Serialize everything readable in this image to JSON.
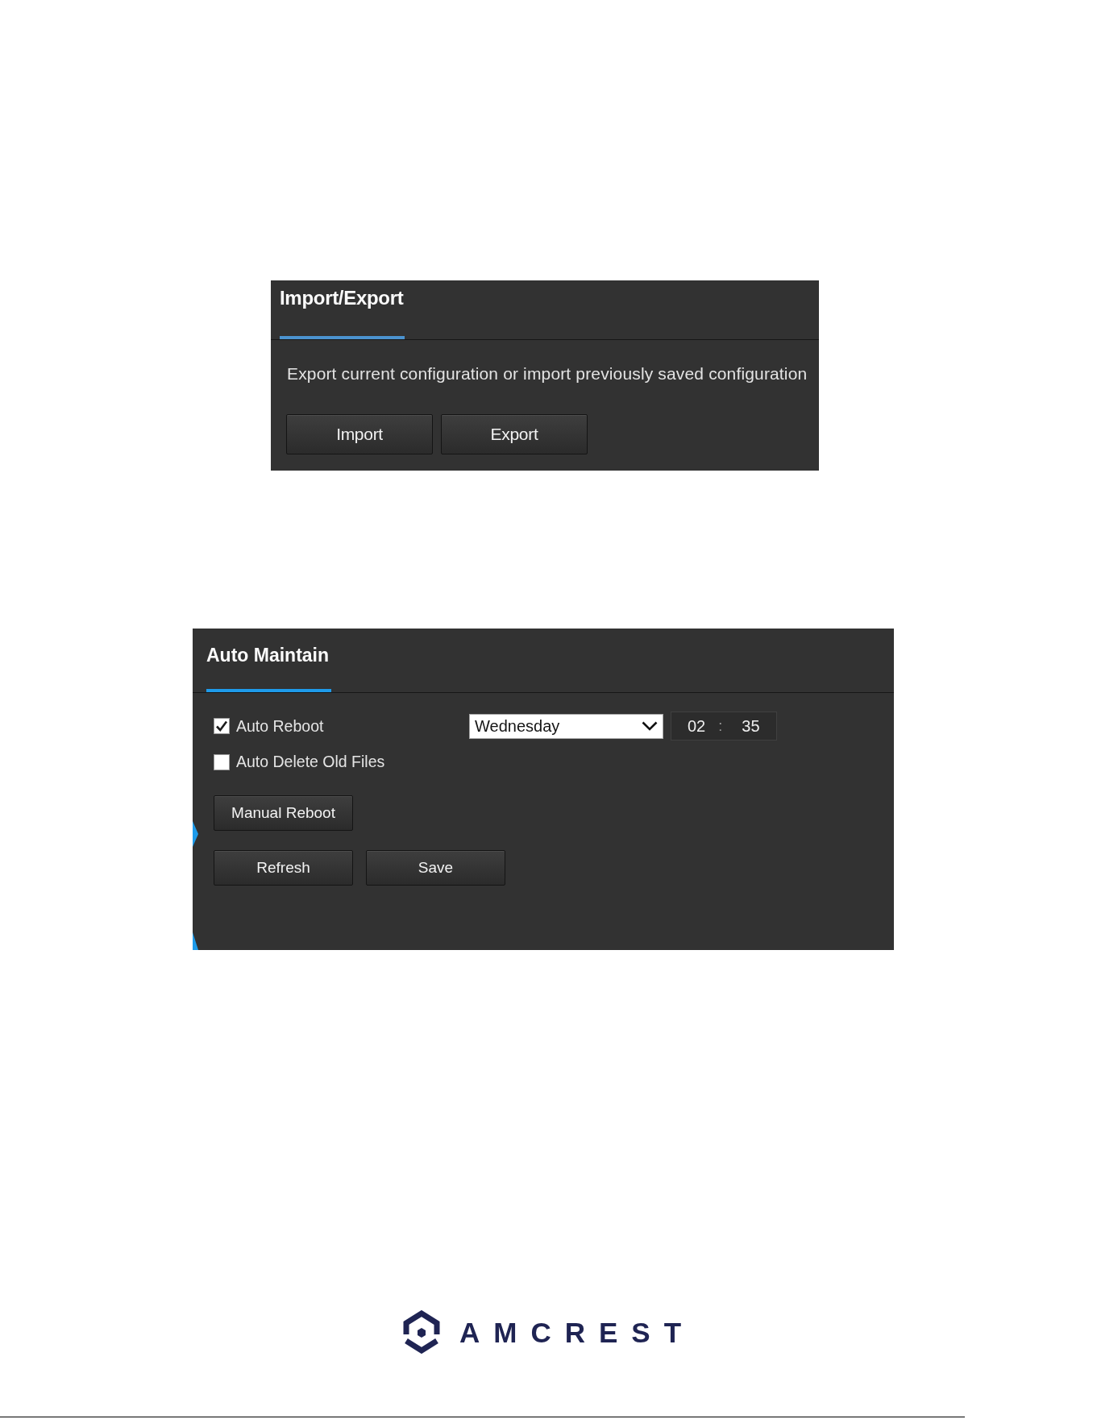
{
  "import_export": {
    "tabs": [
      {
        "label": "Import/Export",
        "selected": true
      }
    ],
    "description": "Export current configuration or import previously saved configuration",
    "buttons": [
      "Import",
      "Export"
    ]
  },
  "auto_maintain": {
    "tabs": [
      {
        "label": "Auto Maintain",
        "selected": true
      }
    ],
    "options": [
      {
        "label": "Auto Reboot",
        "checked": true,
        "day": "Wednesday",
        "hour": "02",
        "separator": ":",
        "minute": "35"
      },
      {
        "label": "Auto Delete Old Files",
        "checked": false
      }
    ],
    "button_rows": [
      [
        "Manual Reboot"
      ],
      [
        "Refresh",
        "Save"
      ]
    ]
  },
  "footer": {
    "logo_text": "AMCREST"
  }
}
